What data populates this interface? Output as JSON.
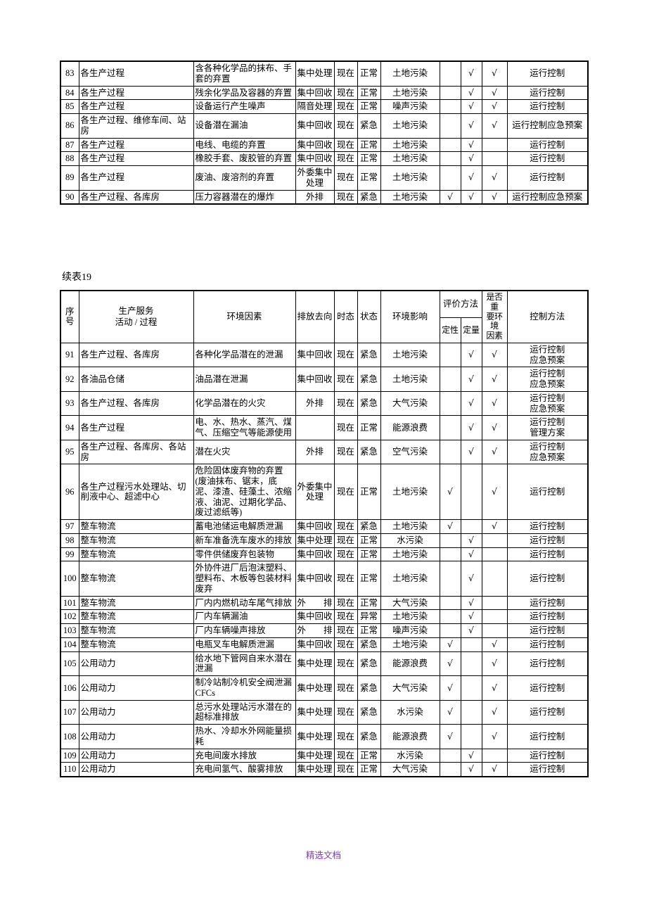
{
  "document": {
    "caption": "续表19",
    "footer_note": "精选文档",
    "footer_color": "#7b3fa0"
  },
  "columns": {
    "no": "序\n号",
    "no_line1": "序",
    "no_line2": "号",
    "activity_line1": "生产服务",
    "activity_line2": "活动 / 过程",
    "factor": "环境因素",
    "discharge": "排放去向",
    "tense": "时态",
    "state": "状态",
    "impact": "环境影响",
    "method_group": "评价方法",
    "qualitative": "定性",
    "quantitative": "定量",
    "significant": "是否重要环境因素",
    "significant_l1": "是否重",
    "significant_l2": "要环境",
    "significant_l3": "因素",
    "control": "控制方法"
  },
  "check_mark": "√",
  "table1": {
    "rows": [
      {
        "no": "83",
        "activity": "各生产过程",
        "factor": "含各种化学品的抹布、手套的弃置",
        "discharge": "集中处理",
        "tense": "现在",
        "state": "正常",
        "impact": "土地污染",
        "qual": "",
        "quant": "√",
        "signif": "√",
        "control": "运行控制"
      },
      {
        "no": "84",
        "activity": "各生产过程",
        "factor": "残余化学品及容器的弃置",
        "discharge": "集中回收",
        "tense": "现在",
        "state": "正常",
        "impact": "土地污染",
        "qual": "",
        "quant": "√",
        "signif": "√",
        "control": "运行控制"
      },
      {
        "no": "85",
        "activity": "各生产过程",
        "factor": "设备运行产生噪声",
        "discharge": "隔音处理",
        "tense": "现在",
        "state": "正常",
        "impact": "噪声污染",
        "qual": "",
        "quant": "√",
        "signif": "√",
        "control": "运行控制"
      },
      {
        "no": "86",
        "activity": "各生产过程、维修车间、站房",
        "factor": "设备潜在漏油",
        "discharge": "集中回收",
        "tense": "现在",
        "state": "紧急",
        "impact": "土地污染",
        "qual": "",
        "quant": "√",
        "signif": "√",
        "control": "运行控制应急预案"
      },
      {
        "no": "87",
        "activity": "各生产过程",
        "factor": "电线、电缆的弃置",
        "discharge": "集中回收",
        "tense": "现在",
        "state": "正常",
        "impact": "土地污染",
        "qual": "",
        "quant": "√",
        "signif": "",
        "control": "运行控制"
      },
      {
        "no": "88",
        "activity": "各生产过程",
        "factor": "橡胶手套、废胶管的弃置",
        "discharge": "集中回收",
        "tense": "现在",
        "state": "正常",
        "impact": "土地污染",
        "qual": "",
        "quant": "√",
        "signif": "",
        "control": "运行控制"
      },
      {
        "no": "89",
        "activity": "各生产过程",
        "factor": "废油、废溶剂的弃置",
        "discharge": "外委集中处理",
        "tense": "现在",
        "state": "正常",
        "impact": "土地污染",
        "qual": "",
        "quant": "√",
        "signif": "√",
        "control": "运行控制"
      },
      {
        "no": "90",
        "activity": "各生产过程、各库房",
        "factor": "压力容器潜在的爆炸",
        "discharge": "外排",
        "tense": "现在",
        "state": "紧急",
        "impact": "土地污染",
        "qual": "√",
        "quant": "√",
        "signif": "√",
        "control": "运行控制应急预案"
      }
    ]
  },
  "table2": {
    "rows": [
      {
        "no": "91",
        "activity": "各生产过程、各库房",
        "factor": "各种化学品潜在的泄漏",
        "discharge": "集中回收",
        "tense": "现在",
        "state": "紧急",
        "impact": "土地污染",
        "qual": "",
        "quant": "√",
        "signif": "√",
        "control": "运行控制\n应急预案"
      },
      {
        "no": "92",
        "activity": "各油品仓储",
        "factor": "油品潜在泄漏",
        "discharge": "集中回收",
        "tense": "现在",
        "state": "紧急",
        "impact": "土地污染",
        "qual": "",
        "quant": "√",
        "signif": "√",
        "control": "运行控制\n应急预案"
      },
      {
        "no": "93",
        "activity": "各生产过程、各库房",
        "factor": "化学品潜在的火灾",
        "discharge": "外排",
        "tense": "现在",
        "state": "紧急",
        "impact": "大气污染",
        "qual": "",
        "quant": "√",
        "signif": "√",
        "control": "运行控制\n应急预案"
      },
      {
        "no": "94",
        "activity": "各生产过程",
        "factor": "电、水、热水、蒸汽、煤气、压缩空气等能源使用",
        "discharge": "",
        "tense": "现在",
        "state": "正常",
        "impact": "能源浪费",
        "qual": "",
        "quant": "√",
        "signif": "√",
        "control": "运行控制\n管理方案"
      },
      {
        "no": "95",
        "activity": "各生产过程、各库房、各站房",
        "factor": "潜在火灾",
        "discharge": "外排",
        "tense": "现在",
        "state": "紧急",
        "impact": "空气污染",
        "qual": "",
        "quant": "√",
        "signif": "√",
        "control": "运行控制\n应急预案"
      },
      {
        "no": "96",
        "activity": "各生产过程污水处理站、切削液中心、超滤中心",
        "factor": "危险固体废弃物的弃置(废油抹布、锯末，底泥、漆渣、硅藻土、浓缩液、油泥、过期化学品、废过滤纸等)",
        "discharge": "外委集中处理",
        "tense": "现在",
        "state": "正常",
        "impact": "土地污染",
        "qual": "√",
        "quant": "",
        "signif": "√",
        "control": "运行控制"
      },
      {
        "no": "97",
        "activity": "整车物流",
        "factor": "蓄电池储运电解质泄漏",
        "discharge": "集中回收",
        "tense": "现在",
        "state": "紧急",
        "impact": "土地污染",
        "qual": "√",
        "quant": "",
        "signif": "√",
        "control": "运行控制"
      },
      {
        "no": "98",
        "activity": "整车物流",
        "factor": "新车准备洗车废水的排放",
        "discharge": "集中处理",
        "tense": "现在",
        "state": "正常",
        "impact": "水污染",
        "qual": "",
        "quant": "√",
        "signif": "",
        "control": "运行控制"
      },
      {
        "no": "99",
        "activity": "整车物流",
        "factor": "零件供储废弃包装物",
        "discharge": "集中回收",
        "tense": "现在",
        "state": "正常",
        "impact": "土地污染",
        "qual": "",
        "quant": "√",
        "signif": "",
        "control": "运行控制"
      },
      {
        "no": "100",
        "activity": "整车物流",
        "factor": "外协件进厂后泡沫塑料、塑料布、木板等包装材料废弃",
        "discharge": "集中回收",
        "tense": "现在",
        "state": "正常",
        "impact": "土地污染",
        "qual": "",
        "quant": "√",
        "signif": "",
        "control": "运行控制"
      },
      {
        "no": "101",
        "activity": "整车物流",
        "factor": "厂内内燃机动车尾气排放",
        "discharge": "外排",
        "discharge_justify": true,
        "tense": "现在",
        "state": "正常",
        "impact": "大气污染",
        "qual": "",
        "quant": "√",
        "signif": "",
        "control": "运行控制"
      },
      {
        "no": "102",
        "activity": "整车物流",
        "factor": "厂内车辆漏油",
        "discharge": "集中回收",
        "tense": "现在",
        "state": "异常",
        "impact": "土地污染",
        "qual": "",
        "quant": "√",
        "signif": "",
        "control": "运行控制"
      },
      {
        "no": "103",
        "activity": "整车物流",
        "factor": "厂内车辆噪声排放",
        "discharge": "外排",
        "discharge_justify": true,
        "tense": "现在",
        "state": "正常",
        "impact": "噪声污染",
        "qual": "",
        "quant": "√",
        "signif": "",
        "control": "运行控制"
      },
      {
        "no": "104",
        "activity": "整车物流",
        "factor": "电瓶叉车电解质泄漏",
        "discharge": "集中回收",
        "tense": "现在",
        "state": "紧急",
        "impact": "土地污染",
        "qual": "√",
        "quant": "",
        "signif": "√",
        "control": "运行控制"
      },
      {
        "no": "105",
        "activity": "公用动力",
        "factor": "给水地下管网自来水潜在泄漏",
        "discharge": "集中处理",
        "tense": "现在",
        "state": "紧急",
        "impact": "能源浪费",
        "qual": "√",
        "quant": "",
        "signif": "√",
        "control": "运行控制"
      },
      {
        "no": "106",
        "activity": "公用动力",
        "factor": "制冷站制冷机安全阀泄漏CFCs",
        "discharge": "集中处理",
        "tense": "现在",
        "state": "紧急",
        "impact": "大气污染",
        "qual": "√",
        "quant": "",
        "signif": "√",
        "control": "运行控制"
      },
      {
        "no": "107",
        "activity": "公用动力",
        "factor": "总污水处理站污水潜在的超标准排放",
        "discharge": "集中处理",
        "tense": "现在",
        "state": "紧急",
        "impact": "水污染",
        "qual": "√",
        "quant": "",
        "signif": "√",
        "control": "运行控制"
      },
      {
        "no": "108",
        "activity": "公用动力",
        "factor": "热水、冷却水外网能量损耗",
        "discharge": "集中处理",
        "tense": "现在",
        "state": "紧急",
        "impact": "能源浪费",
        "qual": "√",
        "quant": "",
        "signif": "√",
        "control": "运行控制"
      },
      {
        "no": "109",
        "activity": "公用动力",
        "factor": "充电间废水排放",
        "discharge": "集中处理",
        "tense": "现在",
        "state": "正常",
        "impact": "水污染",
        "qual": "",
        "quant": "√",
        "signif": "",
        "control": "运行控制"
      },
      {
        "no": "110",
        "activity": "公用动力",
        "factor": "充电间氢气、酸雾排放",
        "discharge": "集中处理",
        "tense": "现在",
        "state": "正常",
        "impact": "大气污染",
        "qual": "",
        "quant": "√",
        "signif": "√",
        "control": "运行控制"
      }
    ]
  }
}
